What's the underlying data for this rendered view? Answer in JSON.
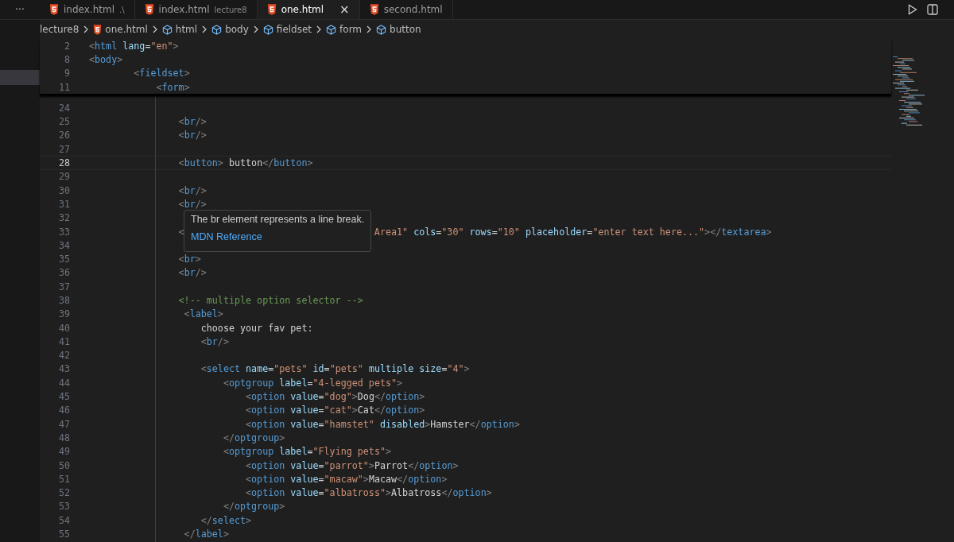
{
  "side_panel": {
    "more": "···"
  },
  "tabs": [
    {
      "label": "index.html",
      "description": ".\\",
      "selected": false
    },
    {
      "label": "index.html",
      "description": "lecture8",
      "selected": false
    },
    {
      "label": "one.html",
      "close": "×",
      "selected": true
    },
    {
      "label": "second.html",
      "selected": false
    }
  ],
  "breadcrumbs": [
    {
      "kind": "folder",
      "label": "lecture8"
    },
    {
      "kind": "file",
      "label": "one.html"
    },
    {
      "kind": "element",
      "label": "html"
    },
    {
      "kind": "element",
      "label": "body"
    },
    {
      "kind": "element",
      "label": "fieldset"
    },
    {
      "kind": "element",
      "label": "form"
    },
    {
      "kind": "element",
      "label": "button"
    }
  ],
  "sticky_lines": [
    {
      "n": "2",
      "tokens": [
        {
          "kind": "p",
          "t": "<"
        },
        {
          "kind": "tag",
          "t": "html"
        },
        {
          "kind": "attr",
          "t": " lang"
        },
        {
          "kind": "text",
          "t": "="
        },
        {
          "kind": "str",
          "t": "\"en\""
        },
        {
          "kind": "p",
          "t": ">"
        }
      ]
    },
    {
      "n": "8",
      "tokens": [
        {
          "kind": "p",
          "t": "<"
        },
        {
          "kind": "tag",
          "t": "body"
        },
        {
          "kind": "p",
          "t": ">"
        }
      ]
    },
    {
      "n": "9",
      "tokens": [
        {
          "kind": "p",
          "t": "        <"
        },
        {
          "kind": "tag",
          "t": "fieldset"
        },
        {
          "kind": "p",
          "t": ">"
        }
      ]
    },
    {
      "n": "11",
      "tokens": [
        {
          "kind": "p",
          "t": "            <"
        },
        {
          "kind": "tag",
          "t": "form"
        },
        {
          "kind": "p",
          "t": ">"
        }
      ]
    }
  ],
  "lines": [
    {
      "n": "24",
      "current": false
    },
    {
      "n": "25",
      "current": false,
      "tokens": [
        {
          "kind": "p",
          "t": "                <"
        },
        {
          "kind": "tag",
          "t": "br"
        },
        {
          "kind": "p",
          "t": "/>"
        }
      ]
    },
    {
      "n": "26",
      "current": false,
      "tokens": [
        {
          "kind": "p",
          "t": "                <"
        },
        {
          "kind": "tag",
          "t": "br"
        },
        {
          "kind": "p",
          "t": "/>"
        }
      ]
    },
    {
      "n": "27",
      "current": false
    },
    {
      "n": "28",
      "current": true,
      "tokens": [
        {
          "kind": "p",
          "t": "                <"
        },
        {
          "kind": "tag",
          "t": "button"
        },
        {
          "kind": "p",
          "t": ">"
        },
        {
          "kind": "text",
          "t": " button"
        },
        {
          "kind": "p",
          "t": "</"
        },
        {
          "kind": "tag",
          "t": "button"
        },
        {
          "kind": "p",
          "t": ">"
        }
      ]
    },
    {
      "n": "29",
      "current": false
    },
    {
      "n": "30",
      "current": false,
      "tokens": [
        {
          "kind": "p",
          "t": "                <"
        },
        {
          "kind": "tag",
          "t": "br"
        },
        {
          "kind": "p",
          "t": "/>"
        }
      ]
    },
    {
      "n": "31",
      "current": false,
      "tokens": [
        {
          "kind": "p",
          "t": "                <"
        },
        {
          "kind": "tag",
          "t": "br"
        },
        {
          "kind": "p",
          "t": "/>"
        }
      ]
    },
    {
      "n": "32",
      "current": false
    },
    {
      "n": "33",
      "current": false,
      "tokens": [
        {
          "kind": "p",
          "t": "                <"
        }
      ],
      "tail": [
        {
          "kind": "str",
          "t": "Area1\""
        },
        {
          "kind": "attr",
          "t": " cols"
        },
        {
          "kind": "text",
          "t": "="
        },
        {
          "kind": "str",
          "t": "\"30\""
        },
        {
          "kind": "attr",
          "t": " rows"
        },
        {
          "kind": "text",
          "t": "="
        },
        {
          "kind": "str",
          "t": "\"10\""
        },
        {
          "kind": "attr",
          "t": " placeholder"
        },
        {
          "kind": "text",
          "t": "="
        },
        {
          "kind": "str",
          "t": "\"enter text here...\""
        },
        {
          "kind": "p",
          "t": "></"
        },
        {
          "kind": "tag",
          "t": "textarea"
        },
        {
          "kind": "p",
          "t": ">"
        }
      ]
    },
    {
      "n": "34",
      "current": false
    },
    {
      "n": "35",
      "current": false,
      "tokens": [
        {
          "kind": "p",
          "t": "                <"
        },
        {
          "kind": "tag",
          "t": "br"
        },
        {
          "kind": "p",
          "t": ">"
        }
      ]
    },
    {
      "n": "36",
      "current": false,
      "tokens": [
        {
          "kind": "p",
          "t": "                <"
        },
        {
          "kind": "tag",
          "t": "br"
        },
        {
          "kind": "p",
          "t": "/>"
        }
      ]
    },
    {
      "n": "37",
      "current": false
    },
    {
      "n": "38",
      "current": false,
      "tokens": [
        {
          "kind": "comment",
          "t": "                <!-- multiple option selector -->"
        }
      ]
    },
    {
      "n": "39",
      "current": false,
      "tokens": [
        {
          "kind": "p",
          "t": "                 <"
        },
        {
          "kind": "tag",
          "t": "label"
        },
        {
          "kind": "p",
          "t": ">"
        }
      ]
    },
    {
      "n": "40",
      "current": false,
      "tokens": [
        {
          "kind": "text",
          "t": "                    choose your fav pet:"
        }
      ]
    },
    {
      "n": "41",
      "current": false,
      "tokens": [
        {
          "kind": "p",
          "t": "                    <"
        },
        {
          "kind": "tag",
          "t": "br"
        },
        {
          "kind": "p",
          "t": "/>"
        }
      ]
    },
    {
      "n": "42",
      "current": false
    },
    {
      "n": "43",
      "current": false,
      "tokens": [
        {
          "kind": "p",
          "t": "                    <"
        },
        {
          "kind": "tag",
          "t": "select"
        },
        {
          "kind": "attr",
          "t": " name"
        },
        {
          "kind": "text",
          "t": "="
        },
        {
          "kind": "str",
          "t": "\"pets\""
        },
        {
          "kind": "attr",
          "t": " id"
        },
        {
          "kind": "text",
          "t": "="
        },
        {
          "kind": "str",
          "t": "\"pets\""
        },
        {
          "kind": "attr",
          "t": " multiple size"
        },
        {
          "kind": "text",
          "t": "="
        },
        {
          "kind": "str",
          "t": "\"4\""
        },
        {
          "kind": "p",
          "t": ">"
        }
      ]
    },
    {
      "n": "44",
      "current": false,
      "tokens": [
        {
          "kind": "p",
          "t": "                        <"
        },
        {
          "kind": "tag",
          "t": "optgroup"
        },
        {
          "kind": "attr",
          "t": " label"
        },
        {
          "kind": "text",
          "t": "="
        },
        {
          "kind": "str",
          "t": "\"4-legged pets\""
        },
        {
          "kind": "p",
          "t": ">"
        }
      ]
    },
    {
      "n": "45",
      "current": false,
      "tokens": [
        {
          "kind": "p",
          "t": "                            <"
        },
        {
          "kind": "tag",
          "t": "option"
        },
        {
          "kind": "attr",
          "t": " value"
        },
        {
          "kind": "text",
          "t": "="
        },
        {
          "kind": "str",
          "t": "\"dog\""
        },
        {
          "kind": "p",
          "t": ">"
        },
        {
          "kind": "text",
          "t": "Dog"
        },
        {
          "kind": "p",
          "t": "</"
        },
        {
          "kind": "tag",
          "t": "option"
        },
        {
          "kind": "p",
          "t": ">"
        }
      ]
    },
    {
      "n": "46",
      "current": false,
      "tokens": [
        {
          "kind": "p",
          "t": "                            <"
        },
        {
          "kind": "tag",
          "t": "option"
        },
        {
          "kind": "attr",
          "t": " value"
        },
        {
          "kind": "text",
          "t": "="
        },
        {
          "kind": "str",
          "t": "\"cat\""
        },
        {
          "kind": "p",
          "t": ">"
        },
        {
          "kind": "text",
          "t": "Cat"
        },
        {
          "kind": "p",
          "t": "</"
        },
        {
          "kind": "tag",
          "t": "option"
        },
        {
          "kind": "p",
          "t": ">"
        }
      ]
    },
    {
      "n": "47",
      "current": false,
      "tokens": [
        {
          "kind": "p",
          "t": "                            <"
        },
        {
          "kind": "tag",
          "t": "option"
        },
        {
          "kind": "attr",
          "t": " value"
        },
        {
          "kind": "text",
          "t": "="
        },
        {
          "kind": "str",
          "t": "\"hamstet\""
        },
        {
          "kind": "attr",
          "t": " disabled"
        },
        {
          "kind": "p",
          "t": ">"
        },
        {
          "kind": "text",
          "t": "Hamster"
        },
        {
          "kind": "p",
          "t": "</"
        },
        {
          "kind": "tag",
          "t": "option"
        },
        {
          "kind": "p",
          "t": ">"
        }
      ]
    },
    {
      "n": "48",
      "current": false,
      "tokens": [
        {
          "kind": "p",
          "t": "                        </"
        },
        {
          "kind": "tag",
          "t": "optgroup"
        },
        {
          "kind": "p",
          "t": ">"
        }
      ]
    },
    {
      "n": "49",
      "current": false,
      "tokens": [
        {
          "kind": "p",
          "t": "                        <"
        },
        {
          "kind": "tag",
          "t": "optgroup"
        },
        {
          "kind": "attr",
          "t": " label"
        },
        {
          "kind": "text",
          "t": "="
        },
        {
          "kind": "str",
          "t": "\"Flying pets\""
        },
        {
          "kind": "p",
          "t": ">"
        }
      ]
    },
    {
      "n": "50",
      "current": false,
      "tokens": [
        {
          "kind": "p",
          "t": "                            <"
        },
        {
          "kind": "tag",
          "t": "option"
        },
        {
          "kind": "attr",
          "t": " value"
        },
        {
          "kind": "text",
          "t": "="
        },
        {
          "kind": "str",
          "t": "\"parrot\""
        },
        {
          "kind": "p",
          "t": ">"
        },
        {
          "kind": "text",
          "t": "Parrot"
        },
        {
          "kind": "p",
          "t": "</"
        },
        {
          "kind": "tag",
          "t": "option"
        },
        {
          "kind": "p",
          "t": ">"
        }
      ]
    },
    {
      "n": "51",
      "current": false,
      "tokens": [
        {
          "kind": "p",
          "t": "                            <"
        },
        {
          "kind": "tag",
          "t": "option"
        },
        {
          "kind": "attr",
          "t": " value"
        },
        {
          "kind": "text",
          "t": "="
        },
        {
          "kind": "str",
          "t": "\"macaw\""
        },
        {
          "kind": "p",
          "t": ">"
        },
        {
          "kind": "text",
          "t": "Macaw"
        },
        {
          "kind": "p",
          "t": "</"
        },
        {
          "kind": "tag",
          "t": "option"
        },
        {
          "kind": "p",
          "t": ">"
        }
      ]
    },
    {
      "n": "52",
      "current": false,
      "tokens": [
        {
          "kind": "p",
          "t": "                            <"
        },
        {
          "kind": "tag",
          "t": "option"
        },
        {
          "kind": "attr",
          "t": " value"
        },
        {
          "kind": "text",
          "t": "="
        },
        {
          "kind": "str",
          "t": "\"albatross\""
        },
        {
          "kind": "p",
          "t": ">"
        },
        {
          "kind": "text",
          "t": "Albatross"
        },
        {
          "kind": "p",
          "t": "</"
        },
        {
          "kind": "tag",
          "t": "option"
        },
        {
          "kind": "p",
          "t": ">"
        }
      ]
    },
    {
      "n": "53",
      "current": false,
      "tokens": [
        {
          "kind": "p",
          "t": "                        </"
        },
        {
          "kind": "tag",
          "t": "optgroup"
        },
        {
          "kind": "p",
          "t": ">"
        }
      ]
    },
    {
      "n": "54",
      "current": false,
      "tokens": [
        {
          "kind": "p",
          "t": "                    </"
        },
        {
          "kind": "tag",
          "t": "select"
        },
        {
          "kind": "p",
          "t": ">"
        }
      ]
    },
    {
      "n": "55",
      "current": false,
      "tokens": [
        {
          "kind": "p",
          "t": "                 </"
        },
        {
          "kind": "tag",
          "t": "label"
        },
        {
          "kind": "p",
          "t": ">"
        }
      ]
    }
  ],
  "hover": {
    "text": "The br element represents a line break.",
    "link": "MDN Reference"
  }
}
